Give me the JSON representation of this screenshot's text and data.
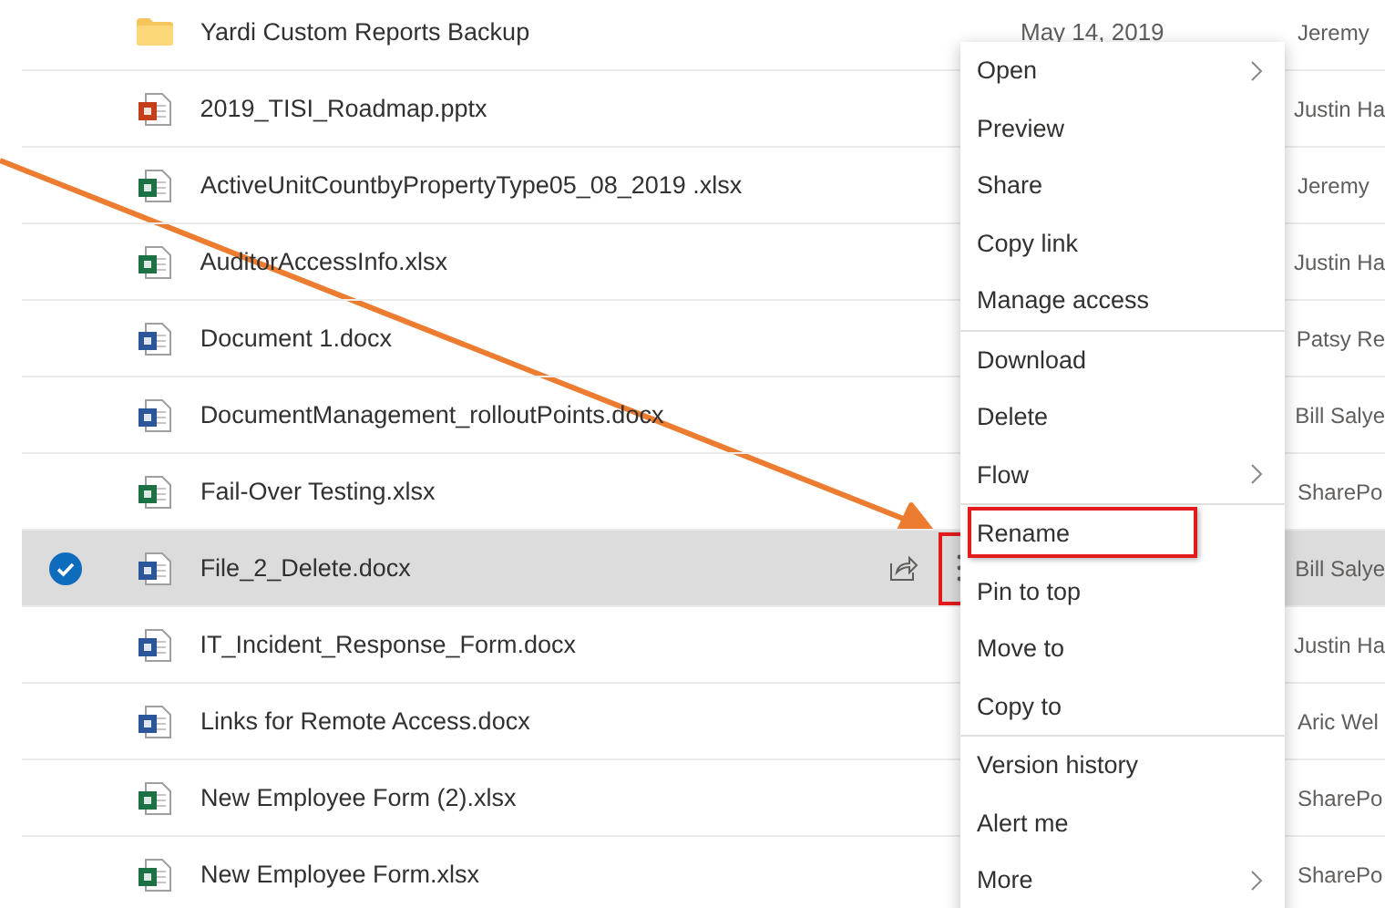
{
  "files": [
    {
      "kind": "folder",
      "name": "Yardi Custom Reports Backup",
      "date": "May 14, 2019",
      "modified_by": "Jeremy",
      "selected": false
    },
    {
      "kind": "pptx",
      "name": "2019_TISI_Roadmap.pptx",
      "modified_by": "Justin Ha",
      "selected": false
    },
    {
      "kind": "xlsx",
      "name": "ActiveUnitCountbyPropertyType05_08_2019 .xlsx",
      "modified_by": "Jeremy",
      "selected": false
    },
    {
      "kind": "xlsx",
      "name": "AuditorAccessInfo.xlsx",
      "modified_by": "Justin Ha",
      "selected": false
    },
    {
      "kind": "docx",
      "name": "Document 1.docx",
      "modified_by": "Patsy Re",
      "selected": false
    },
    {
      "kind": "docx",
      "name": "DocumentManagement_rolloutPoints.docx",
      "modified_by": "Bill Salye",
      "selected": false
    },
    {
      "kind": "xlsx",
      "name": "Fail-Over Testing.xlsx",
      "modified_by": "SharePo",
      "selected": false
    },
    {
      "kind": "docx",
      "name": "File_2_Delete.docx",
      "modified_by": "Bill Salye",
      "selected": true,
      "more_highlighted": true
    },
    {
      "kind": "docx",
      "name": "IT_Incident_Response_Form.docx",
      "modified_by": "Justin Ha",
      "selected": false
    },
    {
      "kind": "docx",
      "name": "Links for Remote Access.docx",
      "modified_by": "Aric Wel",
      "selected": false
    },
    {
      "kind": "xlsx",
      "name": "New Employee Form (2).xlsx",
      "modified_by": "SharePo",
      "selected": false
    },
    {
      "kind": "xlsx",
      "name": "New Employee Form.xlsx",
      "modified_by": "SharePo",
      "selected": false
    }
  ],
  "context_menu": {
    "groups": [
      [
        {
          "label": "Open",
          "submenu": true,
          "highlighted": false
        },
        {
          "label": "Preview",
          "submenu": false,
          "highlighted": false
        },
        {
          "label": "Share",
          "submenu": false,
          "highlighted": false
        },
        {
          "label": "Copy link",
          "submenu": false,
          "highlighted": false
        },
        {
          "label": "Manage access",
          "submenu": false,
          "highlighted": false
        }
      ],
      [
        {
          "label": "Download",
          "submenu": false,
          "highlighted": false
        },
        {
          "label": "Delete",
          "submenu": false,
          "highlighted": false
        },
        {
          "label": "Flow",
          "submenu": true,
          "highlighted": false
        }
      ],
      [
        {
          "label": "Rename",
          "submenu": false,
          "highlighted": true
        },
        {
          "label": "Pin to top",
          "submenu": false,
          "highlighted": false
        },
        {
          "label": "Move to",
          "submenu": false,
          "highlighted": false
        },
        {
          "label": "Copy to",
          "submenu": false,
          "highlighted": false
        }
      ],
      [
        {
          "label": "Version history",
          "submenu": false,
          "highlighted": false
        },
        {
          "label": "Alert me",
          "submenu": false,
          "highlighted": false
        },
        {
          "label": "More",
          "submenu": true,
          "highlighted": false
        }
      ]
    ]
  },
  "callout_arrow": true
}
